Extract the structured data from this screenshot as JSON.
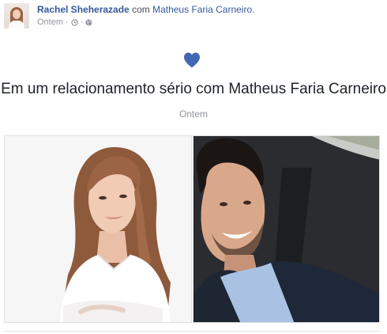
{
  "post": {
    "author_name": "Rachel Sheherazade",
    "with_text": "com",
    "tagged_name": "Matheus Faria Carneiro.",
    "timestamp": "Ontem",
    "separator": "·",
    "privacy_icon": "globe-icon",
    "time_icon": "clock-icon"
  },
  "life_event": {
    "icon": "heart-icon",
    "icon_color": "#4267b2",
    "title": "Em um relacionamento sério com Matheus Faria Carneiro",
    "date": "Ontem"
  },
  "photos": [
    {
      "subject": "woman-portrait"
    },
    {
      "subject": "man-selfie-in-car"
    }
  ],
  "colors": {
    "link": "#365899",
    "meta": "#90949c",
    "title": "#1d2129"
  }
}
